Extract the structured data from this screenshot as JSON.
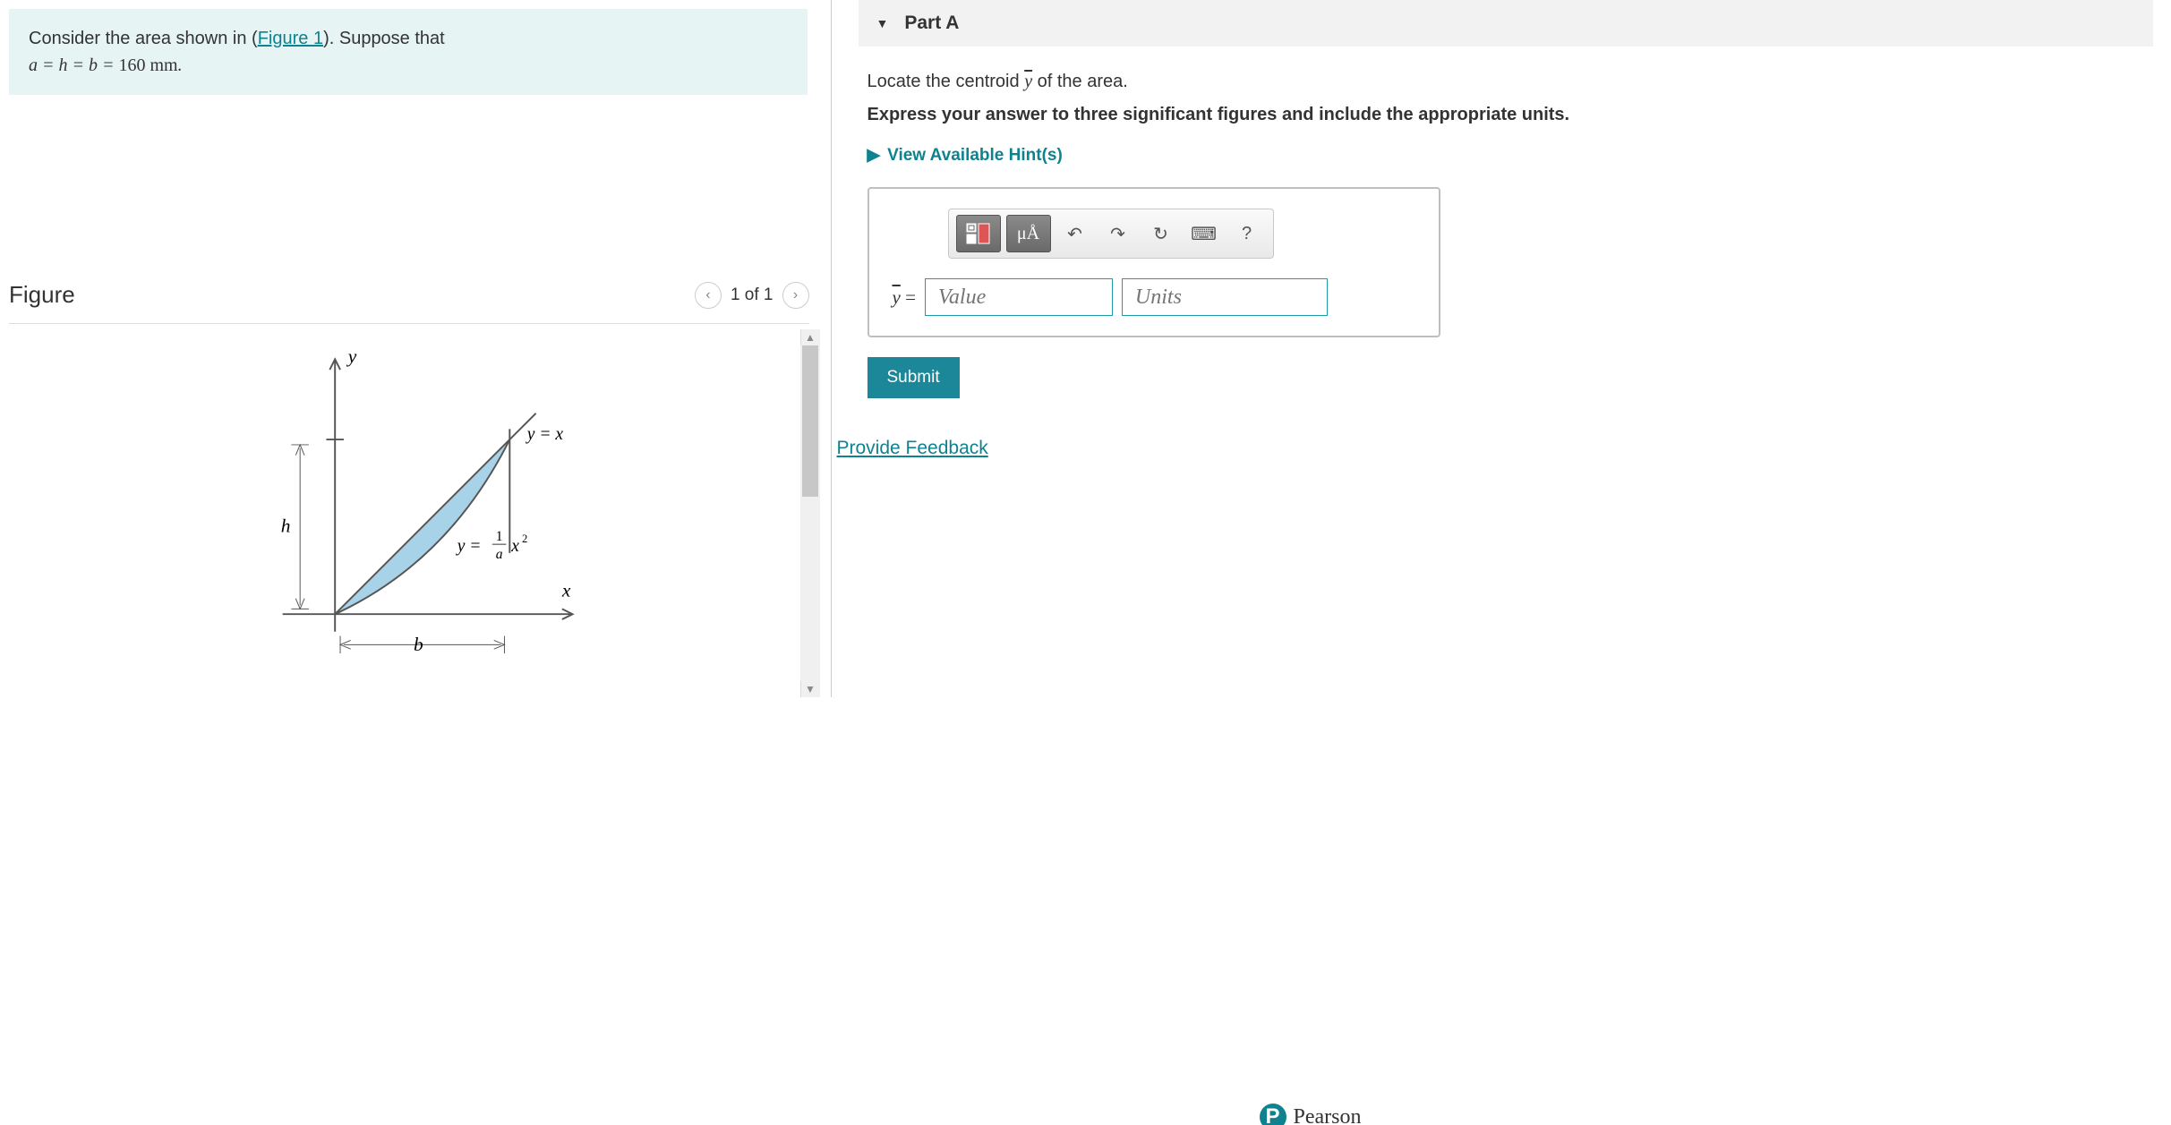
{
  "left": {
    "prompt_prefix": "Consider the area shown in (",
    "figure_link": "Figure 1",
    "prompt_suffix": "). Suppose that",
    "equation_text": "a = h = b = 160 mm.",
    "figure_title": "Figure",
    "figure_counter": "1 of 1",
    "diagram": {
      "y_axis": "y",
      "x_axis": "x",
      "h_label": "h",
      "b_label": "b",
      "curve1": "y = x",
      "curve2_lhs": "y =",
      "curve2_frac_top": "1",
      "curve2_frac_bot": "a",
      "curve2_rhs": "x",
      "curve2_sup": "2"
    }
  },
  "right": {
    "part_label": "Part A",
    "instruction1_pre": "Locate the centroid ",
    "instruction1_var": "y",
    "instruction1_post": " of the area.",
    "instruction2": "Express your answer to three significant figures and include the appropriate units.",
    "hints_label": "View Available Hint(s)",
    "toolbar": {
      "templates": "templates-icon",
      "symbols": "μÅ",
      "undo": "↶",
      "redo": "↷",
      "reset": "↻",
      "keyboard": "⌨",
      "help": "?"
    },
    "ybar_eq": "y",
    "equals": " = ",
    "value_placeholder": "Value",
    "units_placeholder": "Units",
    "submit_label": "Submit",
    "feedback_label": "Provide Feedback"
  },
  "footer": {
    "brand": "Pearson"
  }
}
